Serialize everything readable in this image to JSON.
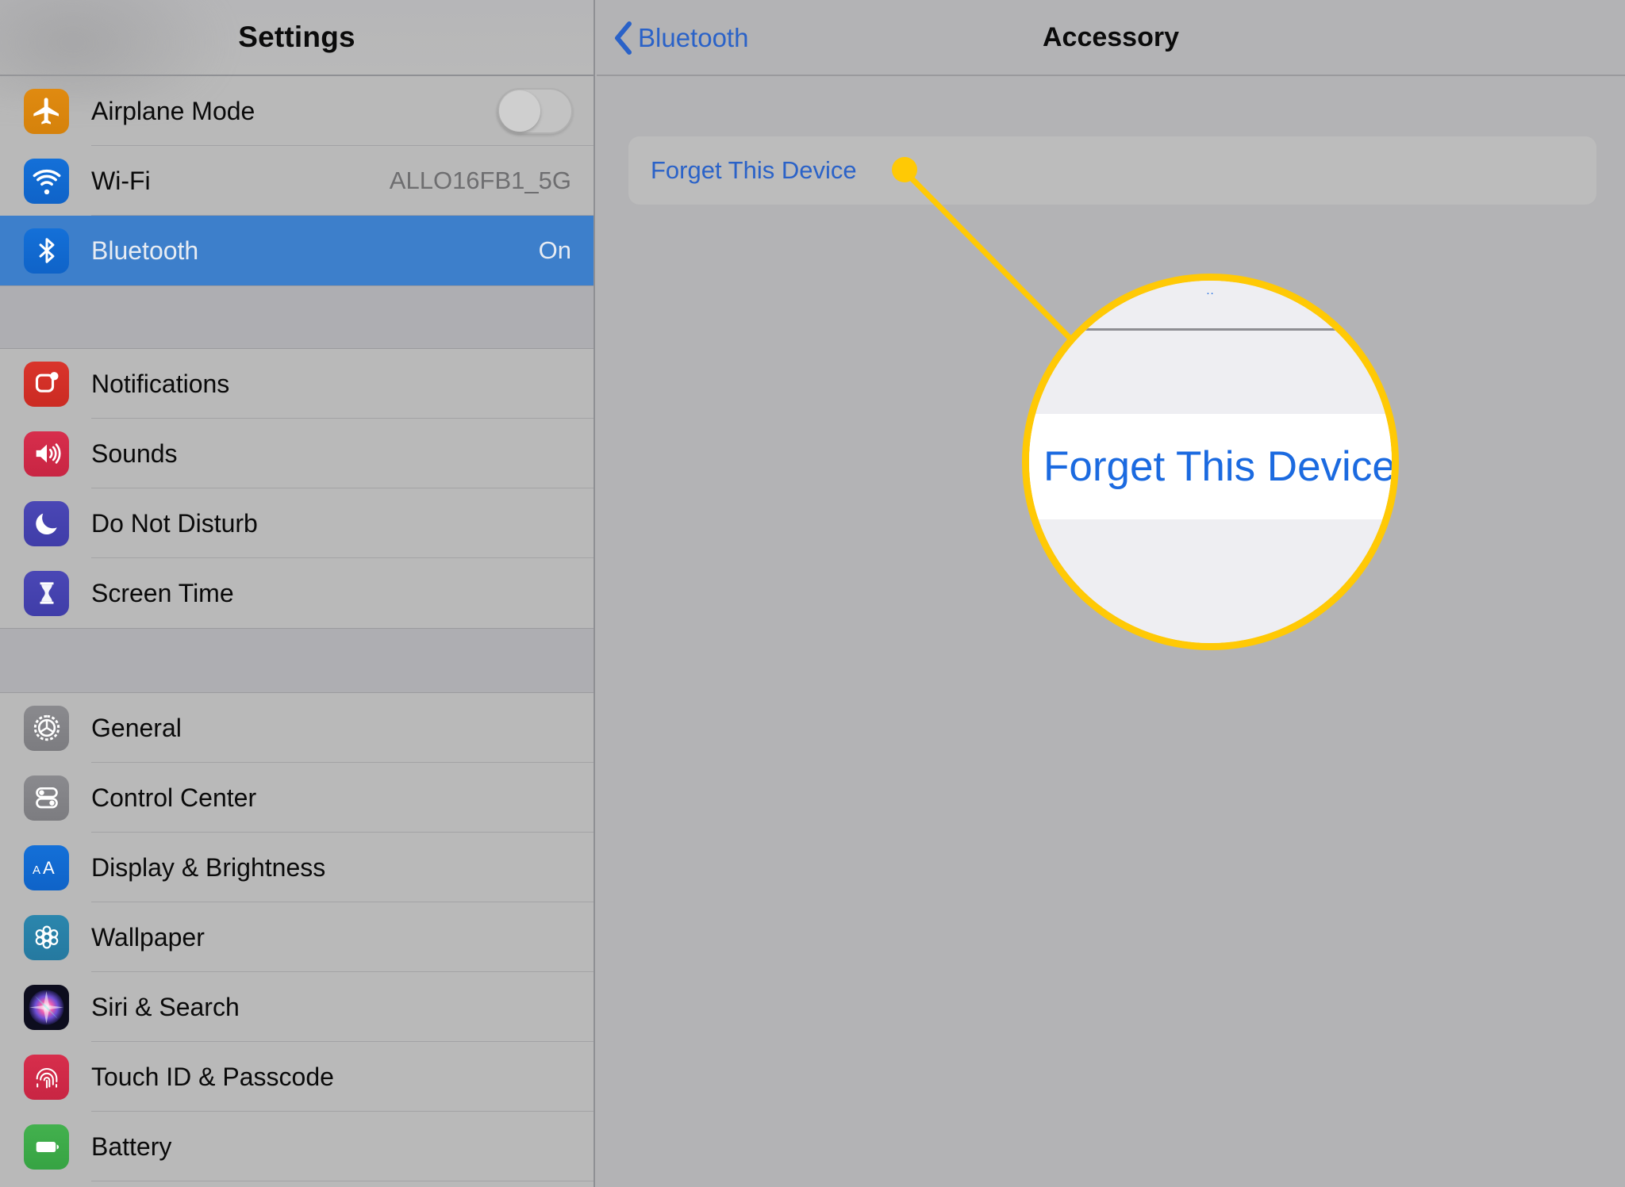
{
  "sidebar": {
    "title": "Settings",
    "groups": [
      {
        "rows": [
          {
            "label": "Airplane Mode",
            "icon": "airplane-icon",
            "control": "toggle",
            "toggle_on": false,
            "value": ""
          },
          {
            "label": "Wi-Fi",
            "icon": "wifi-icon",
            "control": "value",
            "value": "ALLO16FB1_5G"
          },
          {
            "label": "Bluetooth",
            "icon": "bluetooth-icon",
            "control": "value",
            "value": "On",
            "selected": true
          }
        ]
      },
      {
        "rows": [
          {
            "label": "Notifications",
            "icon": "notifications-icon",
            "control": "none",
            "value": ""
          },
          {
            "label": "Sounds",
            "icon": "sounds-icon",
            "control": "none",
            "value": ""
          },
          {
            "label": "Do Not Disturb",
            "icon": "do-not-disturb-icon",
            "control": "none",
            "value": ""
          },
          {
            "label": "Screen Time",
            "icon": "screen-time-icon",
            "control": "none",
            "value": ""
          }
        ]
      },
      {
        "rows": [
          {
            "label": "General",
            "icon": "gear-icon",
            "control": "none",
            "value": ""
          },
          {
            "label": "Control Center",
            "icon": "control-center-icon",
            "control": "none",
            "value": ""
          },
          {
            "label": "Display & Brightness",
            "icon": "display-brightness-icon",
            "control": "none",
            "value": ""
          },
          {
            "label": "Wallpaper",
            "icon": "wallpaper-icon",
            "control": "none",
            "value": ""
          },
          {
            "label": "Siri & Search",
            "icon": "siri-icon",
            "control": "none",
            "value": ""
          },
          {
            "label": "Touch ID & Passcode",
            "icon": "touch-id-icon",
            "control": "none",
            "value": ""
          },
          {
            "label": "Battery",
            "icon": "battery-icon",
            "control": "none",
            "value": ""
          }
        ]
      }
    ]
  },
  "detail": {
    "back_label": "Bluetooth",
    "title": "Accessory",
    "forget_button_label": "Forget This Device"
  },
  "callout": {
    "magnified_label": "Forget This Device",
    "magnified_tiny_text": "..",
    "highlight_color": "#ffc905"
  }
}
